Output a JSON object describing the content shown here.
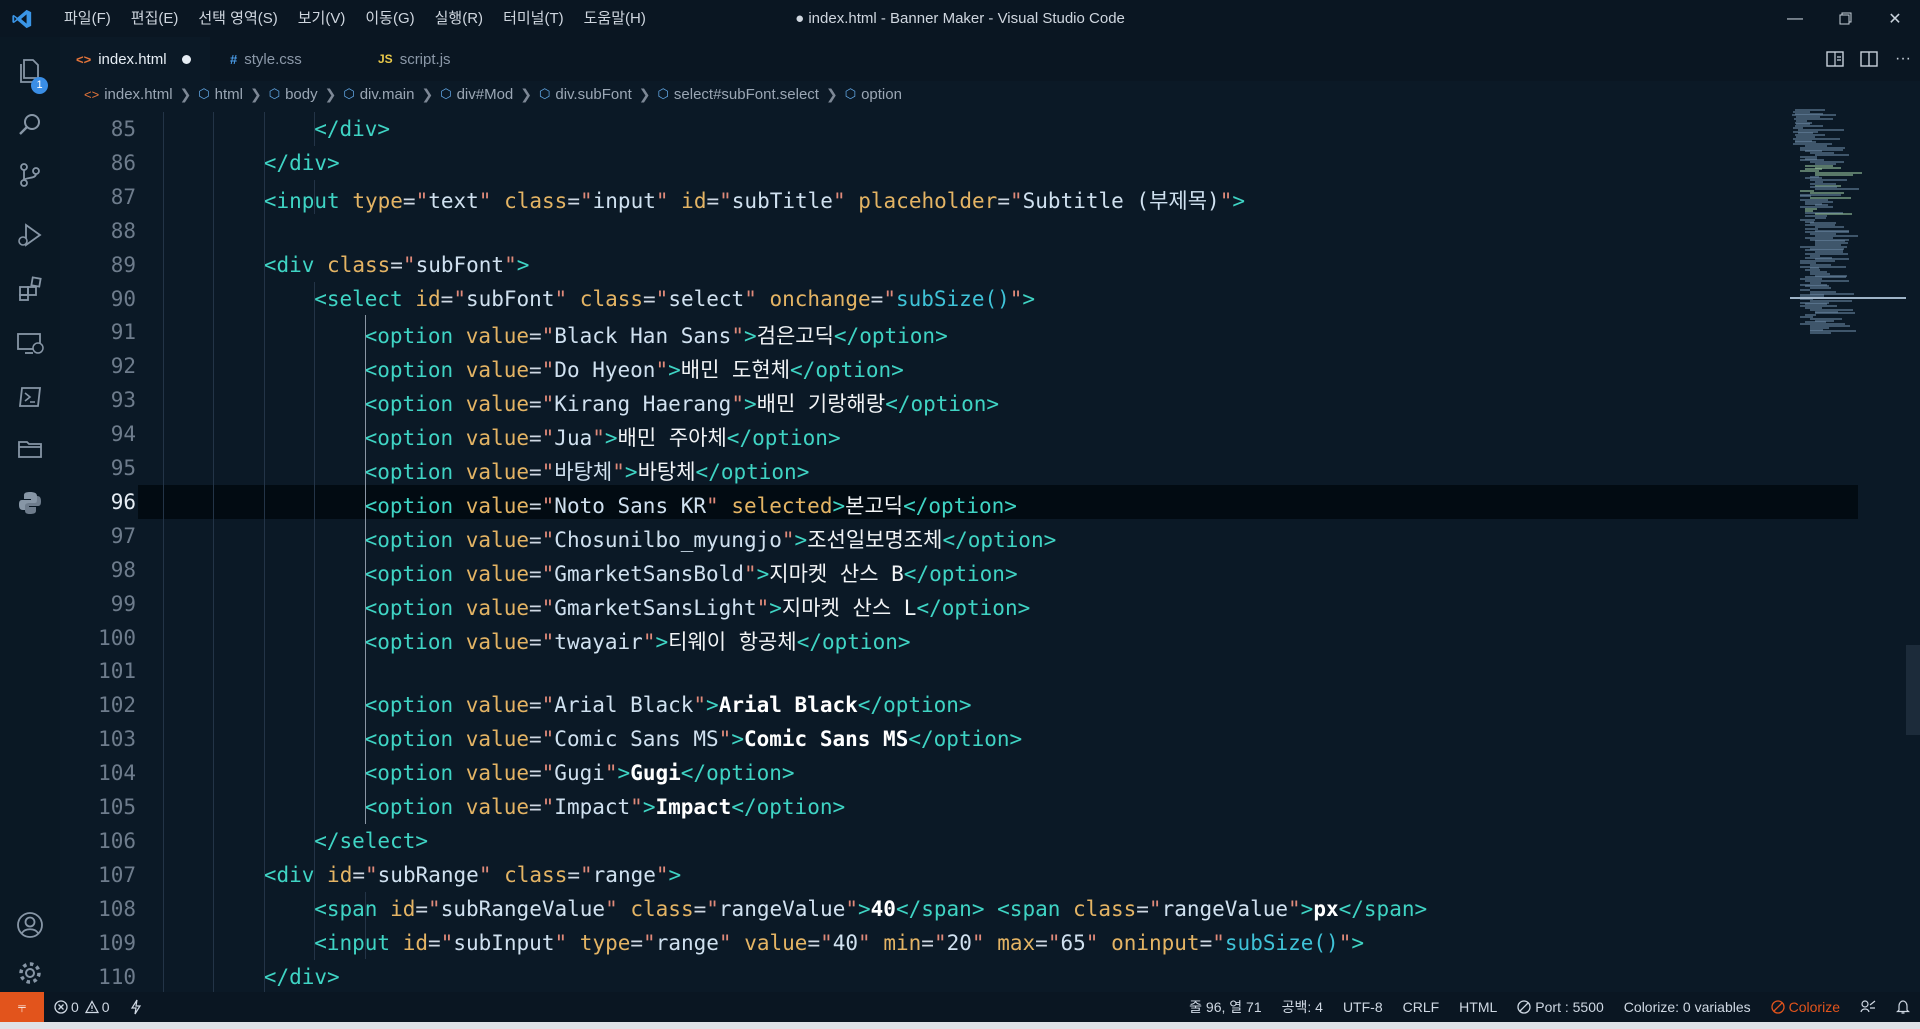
{
  "window": {
    "title": "● index.html - Banner Maker - Visual Studio Code",
    "menu": [
      "파일(F)",
      "편집(E)",
      "선택 영역(S)",
      "보기(V)",
      "이동(G)",
      "실행(R)",
      "터미널(T)",
      "도움말(H)"
    ]
  },
  "activity": {
    "explorer_badge": "1"
  },
  "tabs": [
    {
      "icon": "<>",
      "label": "index.html"
    },
    {
      "icon": "#",
      "label": "style.css"
    },
    {
      "icon": "JS",
      "label": "script.js"
    }
  ],
  "breadcrumb": [
    "index.html",
    "html",
    "body",
    "div.main",
    "div#Mod",
    "div.subFont",
    "select#subFont.select",
    "option"
  ],
  "editor": {
    "current_line": "96",
    "lines": [
      {
        "n": "85",
        "t": "</div>"
      },
      {
        "n": "86",
        "t": "</div>"
      },
      {
        "n": "87",
        "t": "<input type=\"text\" class=\"input\" id=\"subTitle\" placeholder=\"Subtitle (부제목)\">"
      },
      {
        "n": "88",
        "t": ""
      },
      {
        "n": "89",
        "t": "<div class=\"subFont\">"
      },
      {
        "n": "90",
        "t": "<select id=\"subFont\" class=\"select\" onchange=\"subSize()\">"
      },
      {
        "n": "91",
        "t": "<option value=\"Black Han Sans\">검은고딕</option>"
      },
      {
        "n": "92",
        "t": "<option value=\"Do Hyeon\">배민 도현체</option>"
      },
      {
        "n": "93",
        "t": "<option value=\"Kirang Haerang\">배민 기랑해랑</option>"
      },
      {
        "n": "94",
        "t": "<option value=\"Jua\">배민 주아체</option>"
      },
      {
        "n": "95",
        "t": "<option value=\"바탕체\">바탕체</option>"
      },
      {
        "n": "96",
        "t": "<option value=\"Noto Sans KR\" selected>본고딕</option>"
      },
      {
        "n": "97",
        "t": "<option value=\"Chosunilbo_myungjo\">조선일보명조체</option>"
      },
      {
        "n": "98",
        "t": "<option value=\"GmarketSansBold\">지마켓 산스 B</option>"
      },
      {
        "n": "99",
        "t": "<option value=\"GmarketSansLight\">지마켓 산스 L</option>"
      },
      {
        "n": "100",
        "t": "<option value=\"twayair\">티웨이 항공체</option>"
      },
      {
        "n": "101",
        "t": ""
      },
      {
        "n": "102",
        "t": "<option value=\"Arial Black\">Arial Black</option>"
      },
      {
        "n": "103",
        "t": "<option value=\"Comic Sans MS\">Comic Sans MS</option>"
      },
      {
        "n": "104",
        "t": "<option value=\"Gugi\">Gugi</option>"
      },
      {
        "n": "105",
        "t": "<option value=\"Impact\">Impact</option>"
      },
      {
        "n": "106",
        "t": "</select>"
      },
      {
        "n": "107",
        "t": "<div id=\"subRange\" class=\"range\">"
      },
      {
        "n": "108",
        "t": "<span id=\"subRangeValue\" class=\"rangeValue\">40</span> <span class=\"rangeValue\">px</span>"
      },
      {
        "n": "109",
        "t": "<input id=\"subInput\" type=\"range\" value=\"40\" min=\"20\" max=\"65\" oninput=\"subSize()\">"
      },
      {
        "n": "110",
        "t": "</div>"
      }
    ]
  },
  "status": {
    "errors": "0",
    "warnings": "0",
    "position": "줄 96, 열 71",
    "spaces": "공백: 4",
    "encoding": "UTF-8",
    "eol": "CRLF",
    "language": "HTML",
    "port": "Port : 5500",
    "colorize_vars": "Colorize: 0 variables",
    "colorize": "Colorize"
  },
  "colors": {
    "accent": "#e2541c",
    "background": "#0b1926",
    "tag": "#3fd4c4",
    "attribute": "#e4b464"
  }
}
